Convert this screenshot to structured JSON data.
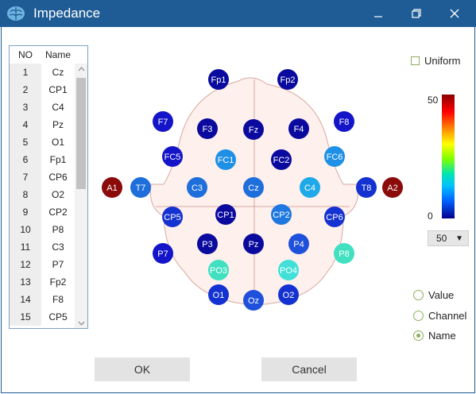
{
  "window": {
    "title": "Impedance",
    "app_icon": "brain-icon",
    "controls": {
      "minimize_icon": "minimize-icon",
      "restore_icon": "restore-icon",
      "close_icon": "close-icon"
    },
    "colors": {
      "titlebar": "#1f5c96"
    }
  },
  "table": {
    "headers": {
      "no": "NO",
      "name": "Name"
    },
    "rows": [
      {
        "no": "1",
        "name": "Cz"
      },
      {
        "no": "2",
        "name": "CP1"
      },
      {
        "no": "3",
        "name": "C4"
      },
      {
        "no": "4",
        "name": "Pz"
      },
      {
        "no": "5",
        "name": "O1"
      },
      {
        "no": "6",
        "name": "Fp1"
      },
      {
        "no": "7",
        "name": "CP6"
      },
      {
        "no": "8",
        "name": "O2"
      },
      {
        "no": "9",
        "name": "CP2"
      },
      {
        "no": "10",
        "name": "P8"
      },
      {
        "no": "11",
        "name": "C3"
      },
      {
        "no": "12",
        "name": "P7"
      },
      {
        "no": "13",
        "name": "Fp2"
      },
      {
        "no": "14",
        "name": "F8"
      },
      {
        "no": "15",
        "name": "CP5"
      }
    ]
  },
  "electrodes": {
    "Fp1": {
      "label": "Fp1",
      "color": "#0a0a9e"
    },
    "Fp2": {
      "label": "Fp2",
      "color": "#0a0a9e"
    },
    "F7": {
      "label": "F7",
      "color": "#1414c8"
    },
    "F3": {
      "label": "F3",
      "color": "#0a0a9e"
    },
    "Fz": {
      "label": "Fz",
      "color": "#0a0a9e"
    },
    "F4": {
      "label": "F4",
      "color": "#0a0a9e"
    },
    "F8": {
      "label": "F8",
      "color": "#1414c8"
    },
    "FC5": {
      "label": "FC5",
      "color": "#1414c8"
    },
    "FC1": {
      "label": "FC1",
      "color": "#1e90e6"
    },
    "FC2": {
      "label": "FC2",
      "color": "#0a0a9e"
    },
    "FC6": {
      "label": "FC6",
      "color": "#1e90e6"
    },
    "A1": {
      "label": "A1",
      "color": "#8b0a0a"
    },
    "T7": {
      "label": "T7",
      "color": "#1e6edc"
    },
    "C3": {
      "label": "C3",
      "color": "#1e6edc"
    },
    "Cz": {
      "label": "Cz",
      "color": "#1e6edc"
    },
    "C4": {
      "label": "C4",
      "color": "#1eaae8"
    },
    "T8": {
      "label": "T8",
      "color": "#1432d2"
    },
    "A2": {
      "label": "A2",
      "color": "#8b0a0a"
    },
    "CP5": {
      "label": "CP5",
      "color": "#1432d2"
    },
    "CP1": {
      "label": "CP1",
      "color": "#0a0a9e"
    },
    "CP2": {
      "label": "CP2",
      "color": "#1e78e0"
    },
    "CP6": {
      "label": "CP6",
      "color": "#1432d2"
    },
    "P7": {
      "label": "P7",
      "color": "#1414c8"
    },
    "P3": {
      "label": "P3",
      "color": "#0a0a9e"
    },
    "Pz": {
      "label": "Pz",
      "color": "#0a0a9e"
    },
    "P4": {
      "label": "P4",
      "color": "#1e50dc"
    },
    "P8": {
      "label": "P8",
      "color": "#40e0c0"
    },
    "PO3": {
      "label": "PO3",
      "color": "#40e0c0"
    },
    "PO4": {
      "label": "PO4",
      "color": "#40e0d8"
    },
    "O1": {
      "label": "O1",
      "color": "#1432d2"
    },
    "Oz": {
      "label": "Oz",
      "color": "#1e50dc"
    },
    "O2": {
      "label": "O2",
      "color": "#1432d2"
    }
  },
  "controls": {
    "uniform_label": "Uniform",
    "uniform_checked": false,
    "scale_max": "50",
    "scale_min": "0",
    "scale_select_value": "50",
    "display_options": [
      {
        "label": "Value",
        "selected": false
      },
      {
        "label": "Channel",
        "selected": false
      },
      {
        "label": "Name",
        "selected": true
      }
    ],
    "ok_label": "OK",
    "cancel_label": "Cancel"
  }
}
